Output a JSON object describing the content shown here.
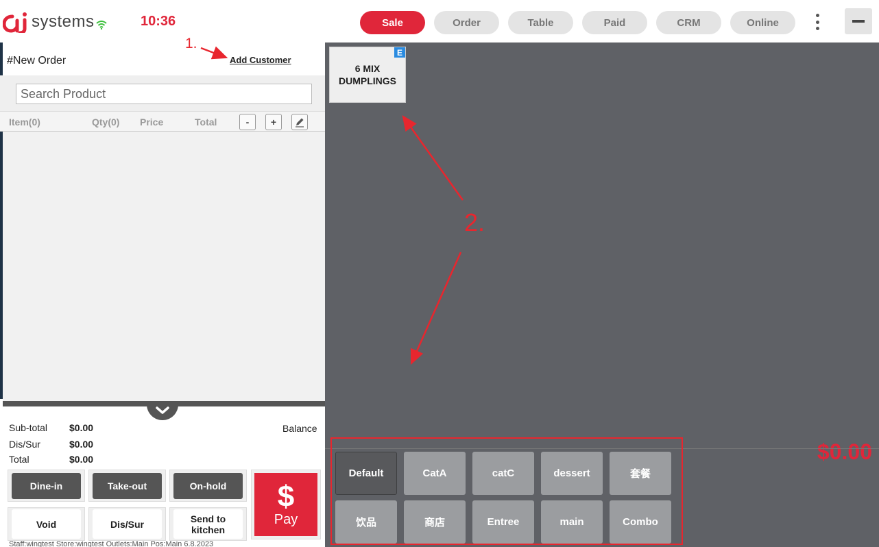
{
  "app": {
    "logo_text": "systems",
    "clock": "10:36"
  },
  "nav": {
    "tabs": [
      "Sale",
      "Order",
      "Table",
      "Paid",
      "CRM",
      "Online"
    ],
    "active": "Sale"
  },
  "order": {
    "title": "#New Order",
    "add_customer": "Add Customer",
    "search_placeholder": "Search Product",
    "columns": {
      "item": "Item(0)",
      "qty": "Qty(0)",
      "price": "Price",
      "total": "Total"
    },
    "minus_label": "-",
    "plus_label": "+"
  },
  "totals": {
    "subtotal_label": "Sub-total",
    "subtotal_value": "$0.00",
    "dissur_label": "Dis/Sur",
    "dissur_value": "$0.00",
    "total_label": "Total",
    "total_value": "$0.00",
    "balance_label": "Balance",
    "balance_value": "$0.00"
  },
  "actions": {
    "dine_in": "Dine-in",
    "take_out": "Take-out",
    "on_hold": "On-hold",
    "void": "Void",
    "dis_sur": "Dis/Sur",
    "send_to_kitchen": "Send to kitchen",
    "pay_symbol": "$",
    "pay": "Pay"
  },
  "status_line": "Staff:wingtest Store:wingtest  Outlets:Main  Pos:Main 6.8.2023",
  "products": [
    {
      "name": "6 MIX DUMPLINGS",
      "badge": "E"
    }
  ],
  "categories": [
    {
      "label": "Default",
      "active": true
    },
    {
      "label": "CatA",
      "active": false
    },
    {
      "label": "catC",
      "active": false
    },
    {
      "label": "dessert",
      "active": false
    },
    {
      "label": "套餐",
      "active": false
    },
    {
      "label": "饮品",
      "active": false
    },
    {
      "label": "商店",
      "active": false
    },
    {
      "label": "Entree",
      "active": false
    },
    {
      "label": "main",
      "active": false
    },
    {
      "label": "Combo",
      "active": false
    }
  ],
  "annotations": {
    "step1": "1.",
    "step2": "2."
  },
  "colors": {
    "accent_red": "#e0263a",
    "tile_badge_blue": "#2a8be0",
    "annotation_red": "#e8262e",
    "wifi_green": "#3bbf3b"
  },
  "icons": [
    "aj-logo-icon",
    "wifi-icon",
    "kebab-menu-icon",
    "minimize-icon",
    "edit-pencil-icon",
    "chevron-down-icon"
  ]
}
